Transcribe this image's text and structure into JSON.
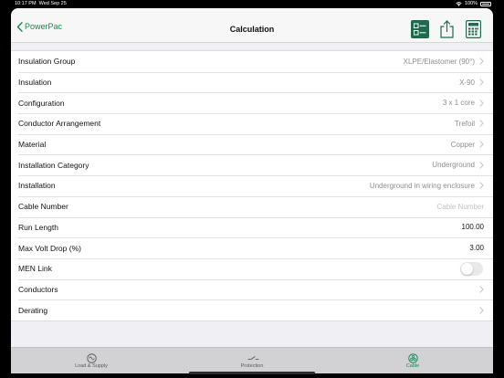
{
  "status": {
    "time": "10:17 PM",
    "date": "Wed Sep 25",
    "battery": "100%"
  },
  "nav": {
    "back_label": "PowerPac",
    "title": "Calculation",
    "icons": [
      "checklist-icon",
      "share-icon",
      "calculator-icon"
    ],
    "accent_color": "#0a8d4f"
  },
  "rows": [
    {
      "label": "Insulation Group",
      "value": "XLPE/Elastomer (90°)"
    },
    {
      "label": "Insulation",
      "value": "X-90"
    },
    {
      "label": "Configuration",
      "value": "3 x 1 core"
    },
    {
      "label": "Conductor Arrangement",
      "value": "Trefoil"
    },
    {
      "label": "Material",
      "value": "Copper"
    },
    {
      "label": "Installation Category",
      "value": "Underground"
    },
    {
      "label": "Installation",
      "value": "Underground in wiring enclosure"
    },
    {
      "label": "Cable Number",
      "placeholder": "Cable Number"
    },
    {
      "label": "Run Length",
      "value": "100.00"
    },
    {
      "label": "Max Volt Drop (%)",
      "value": "3.00"
    },
    {
      "label": "MEN Link",
      "toggle": false
    },
    {
      "label": "Conductors"
    },
    {
      "label": "Derating"
    }
  ],
  "tabs": [
    {
      "label": "Load & Supply",
      "icon": "sine-wave-icon",
      "active": false
    },
    {
      "label": "Protection",
      "icon": "breaker-icon",
      "active": false
    },
    {
      "label": "Cable",
      "icon": "cable-icon",
      "active": true
    }
  ]
}
